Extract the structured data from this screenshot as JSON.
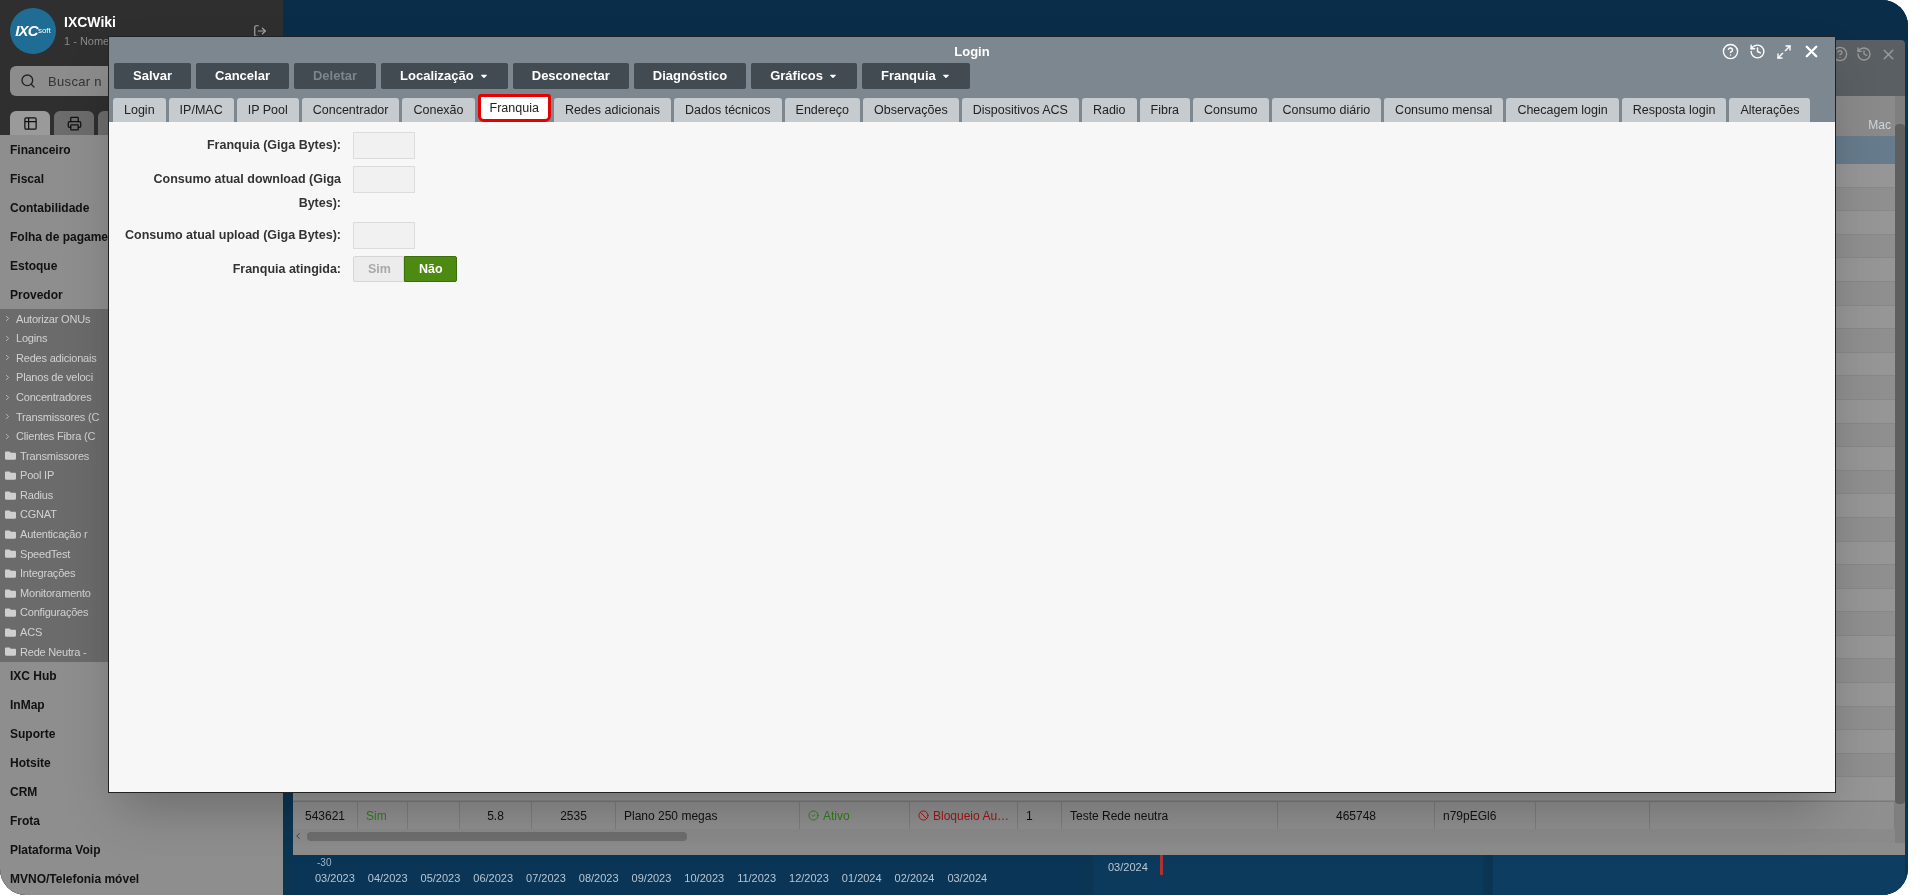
{
  "sidebar": {
    "brand": {
      "logo_main": "IXC",
      "logo_sub": "soft",
      "app_name": "IXCWiki",
      "subtitle": "1 - Nome"
    },
    "search": {
      "placeholder": "Buscar n"
    },
    "tabs": [
      {
        "selected": true
      },
      {
        "selected": false
      },
      {
        "selected": false
      }
    ],
    "menu": [
      {
        "label": "Financeiro"
      },
      {
        "label": "Fiscal"
      },
      {
        "label": "Contabilidade"
      },
      {
        "label": "Folha de pagame"
      },
      {
        "label": "Estoque"
      },
      {
        "label": "Provedor",
        "expanded": true,
        "children": [
          {
            "label": "Autorizar ONUs",
            "kind": "link"
          },
          {
            "label": "Logins",
            "kind": "link"
          },
          {
            "label": "Redes adicionais",
            "kind": "link"
          },
          {
            "label": "Planos de veloci",
            "kind": "link"
          },
          {
            "label": "Concentradores",
            "kind": "link"
          },
          {
            "label": "Transmissores (C",
            "kind": "link"
          },
          {
            "label": "Clientes Fibra (C",
            "kind": "link"
          },
          {
            "label": "Transmissores",
            "kind": "folder"
          },
          {
            "label": "Pool IP",
            "kind": "folder"
          },
          {
            "label": "Radius",
            "kind": "folder"
          },
          {
            "label": "CGNAT",
            "kind": "folder"
          },
          {
            "label": "Autenticação r",
            "kind": "folder"
          },
          {
            "label": "SpeedTest",
            "kind": "folder"
          },
          {
            "label": "Integrações",
            "kind": "folder"
          },
          {
            "label": "Monitoramento",
            "kind": "folder"
          },
          {
            "label": "Configurações",
            "kind": "folder"
          },
          {
            "label": "ACS",
            "kind": "folder"
          },
          {
            "label": "Rede Neutra -",
            "kind": "folder"
          }
        ]
      },
      {
        "label": "IXC Hub"
      },
      {
        "label": "InMap"
      },
      {
        "label": "Suporte"
      },
      {
        "label": "Hotsite"
      },
      {
        "label": "CRM"
      },
      {
        "label": "Frota"
      },
      {
        "label": "Plataforma Voip"
      },
      {
        "label": "MVNO/Telefonia móvel"
      }
    ]
  },
  "background_window": {
    "table": {
      "column_header": "Mac",
      "row": [
        {
          "text": "543621",
          "kind": "plain"
        },
        {
          "text": "Sim",
          "kind": "positive"
        },
        {
          "text": "5.8",
          "kind": "plain"
        },
        {
          "text": "2535",
          "kind": "plain"
        },
        {
          "text": "Plano 250 megas",
          "kind": "plain"
        },
        {
          "text": "Ativo",
          "kind": "status_ok"
        },
        {
          "text": "Bloqueio Au…",
          "kind": "status_blocked"
        },
        {
          "text": "1",
          "kind": "plain"
        },
        {
          "text": "Teste Rede neutra",
          "kind": "plain"
        },
        {
          "text": "465748",
          "kind": "plain"
        },
        {
          "text": "n79pEGl6",
          "kind": "plain"
        }
      ]
    }
  },
  "background_chart": {
    "y_tick": "-30",
    "x_labels": [
      "03/2023",
      "04/2023",
      "05/2023",
      "06/2023",
      "07/2023",
      "08/2023",
      "09/2023",
      "10/2023",
      "11/2023",
      "12/2023",
      "01/2024",
      "02/2024",
      "03/2024"
    ],
    "second_label": "03/2024"
  },
  "dialog": {
    "title": "Login",
    "toolbar": [
      {
        "label": "Salvar",
        "kind": "button",
        "disabled": false
      },
      {
        "label": "Cancelar",
        "kind": "button",
        "disabled": false
      },
      {
        "label": "Deletar",
        "kind": "button",
        "disabled": true
      },
      {
        "label": "Localização",
        "kind": "dropdown",
        "disabled": false
      },
      {
        "label": "Desconectar",
        "kind": "button",
        "disabled": false
      },
      {
        "label": "Diagnóstico",
        "kind": "button",
        "disabled": false
      },
      {
        "label": "Gráficos",
        "kind": "dropdown",
        "disabled": false
      },
      {
        "label": "Franquia",
        "kind": "dropdown",
        "disabled": false
      }
    ],
    "tabs": [
      {
        "label": "Login",
        "selected": false
      },
      {
        "label": "IP/MAC",
        "selected": false
      },
      {
        "label": "IP Pool",
        "selected": false
      },
      {
        "label": "Concentrador",
        "selected": false
      },
      {
        "label": "Conexão",
        "selected": false
      },
      {
        "label": "Franquia",
        "selected": true
      },
      {
        "label": "Redes adicionais",
        "selected": false
      },
      {
        "label": "Dados técnicos",
        "selected": false
      },
      {
        "label": "Endereço",
        "selected": false
      },
      {
        "label": "Observações",
        "selected": false
      },
      {
        "label": "Dispositivos ACS",
        "selected": false
      },
      {
        "label": "Radio",
        "selected": false
      },
      {
        "label": "Fibra",
        "selected": false
      },
      {
        "label": "Consumo",
        "selected": false
      },
      {
        "label": "Consumo diário",
        "selected": false
      },
      {
        "label": "Consumo mensal",
        "selected": false
      },
      {
        "label": "Checagem login",
        "selected": false
      },
      {
        "label": "Resposta login",
        "selected": false
      },
      {
        "label": "Alterações",
        "selected": false
      }
    ],
    "form": [
      {
        "label": "Franquia (Giga Bytes):",
        "kind": "input"
      },
      {
        "label": "Consumo atual download (Giga Bytes):",
        "kind": "input"
      },
      {
        "label": "Consumo atual upload (Giga Bytes):",
        "kind": "input"
      },
      {
        "label": "Franquia atingida:",
        "kind": "toggle",
        "options": [
          {
            "label": "Sim",
            "selected": false
          },
          {
            "label": "Não",
            "selected": true
          }
        ]
      }
    ]
  }
}
